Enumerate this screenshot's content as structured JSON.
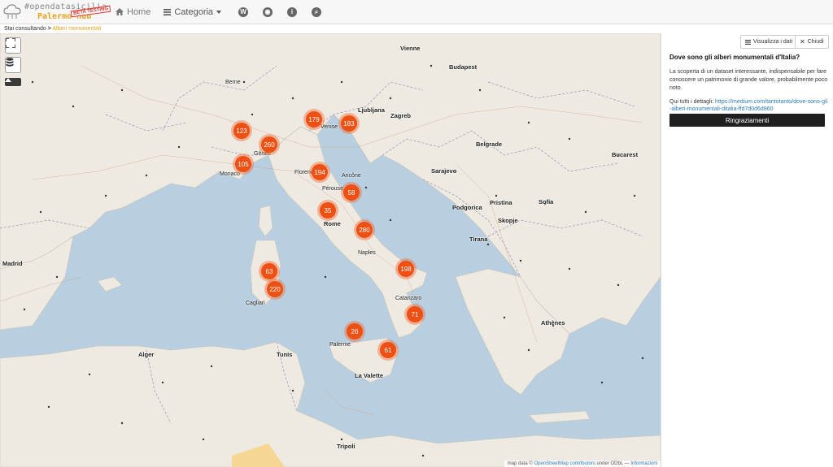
{
  "logo": {
    "line1": "#opendatasicilia",
    "line2": "Palermo Hub",
    "badge": "BETA TESTING"
  },
  "nav": {
    "home_label": "Home",
    "category_label": "Categoria",
    "icons": [
      "wordpress-icon",
      "eye-icon",
      "info-icon",
      "search-icon"
    ]
  },
  "breadcrumb": {
    "prefix": "Stai consultando",
    "current": "Alberi monumentali"
  },
  "panel": {
    "view_data_label": "Visualizza i dati",
    "close_label": "Chiudi",
    "title": "Dove sono gli alberi monumentali d'Italia?",
    "description": "La scoperta di un dataset interessante, indispensabile per fare conoscere un patrimonio di grande valore, probabilmente poco noto.",
    "details_prefix": "Qui tutti i dettagli:",
    "details_link": "https://medium.com/tantotanto/dove-sono-gli-alberi-monumentali-ditalia-ffd7d0d6d860",
    "thanks_label": "Ringraziamenti"
  },
  "map": {
    "clusters": [
      "123",
      "179",
      "183",
      "260",
      "105",
      "194",
      "58",
      "35",
      "280",
      "63",
      "220",
      "198",
      "71",
      "26",
      "61"
    ],
    "cities": [
      "Berne",
      "Monaco",
      "Venise",
      "Ljubljana",
      "Zagreb",
      "Budapest",
      "Vienne",
      "Belgrade",
      "Sarajevo",
      "Podgorica",
      "Pristina",
      "Skopje",
      "Sofia",
      "Bucarest",
      "Tirana",
      "Rome",
      "Florence",
      "Naples",
      "Alger",
      "Tunis",
      "La Valette",
      "Tripoli",
      "Madrid",
      "Athènes",
      "Catanzaro",
      "Palerme",
      "Gênes",
      "Ancône",
      "Pérouse",
      "Cagliari"
    ],
    "attribution_prefix": "map data ©",
    "attribution_link": "OpenStreetMap contributors",
    "attribution_mid": "under ODbL —",
    "attribution_info": "Informazioni"
  },
  "colors": {
    "cluster": "#ee4f12",
    "sea": "#b7cfe0",
    "land": "#eeeae1",
    "accent": "#e8a21c"
  }
}
